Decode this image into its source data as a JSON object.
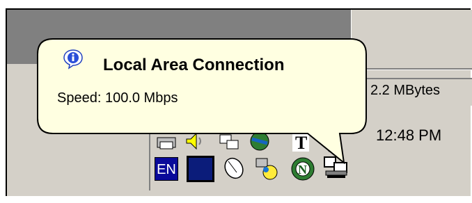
{
  "balloon": {
    "title": "Local Area Connection",
    "text": "Speed: 100.0 Mbps",
    "icon": "info-icon"
  },
  "status": {
    "transfer": "2.2 MBytes"
  },
  "taskbar": {
    "clock": "12:48 PM",
    "language": "EN",
    "tray_icons": [
      "printer-icon",
      "volume-icon",
      "network-connect-icon",
      "globe-icon",
      "font-icon",
      "arrow-icon",
      "keyboard-layout-icon",
      "mouse-icon",
      "network-search-icon",
      "netscape-icon",
      "lan-connection-icon"
    ]
  },
  "colors": {
    "balloon_bg": "#ffffe1",
    "face": "#d4d0c8",
    "shadow": "#808080",
    "titlebar": "#808080"
  }
}
